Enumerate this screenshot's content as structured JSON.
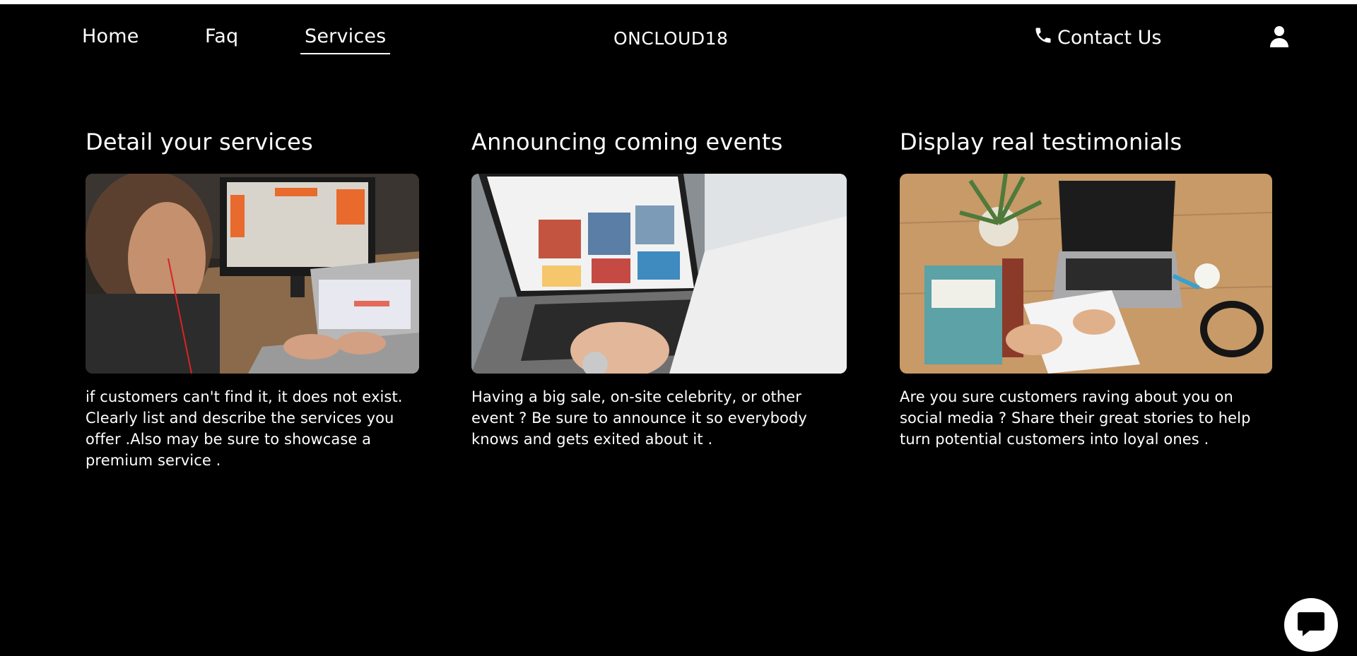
{
  "nav": {
    "home": "Home",
    "faq": "Faq",
    "services": "Services"
  },
  "brand": "ONCLOUD18",
  "contact": {
    "label": "Contact Us",
    "icon": "phone-icon"
  },
  "account_icon": "user-icon",
  "cards": [
    {
      "title": "Detail your services",
      "image": "man-working-at-monitor-and-laptop",
      "text": "if customers can't find it, it does not exist. Clearly list and describe the services you offer .Also may be sure to showcase a premium service ."
    },
    {
      "title": "Announcing coming events",
      "image": "hands-typing-on-laptop-marketplace",
      "text": "Having a big sale, on-site celebrity, or other event ? Be sure to announce it so everybody knows and gets exited about it ."
    },
    {
      "title": "Display real testimonials",
      "image": "desk-with-laptop-book-plant-headphones",
      "text": "Are you sure customers raving about you on social media ? Share their great stories to help turn potential customers into loyal ones ."
    }
  ],
  "chat_icon": "chat-icon",
  "colors": {
    "background": "#000000",
    "text": "#ffffff"
  }
}
